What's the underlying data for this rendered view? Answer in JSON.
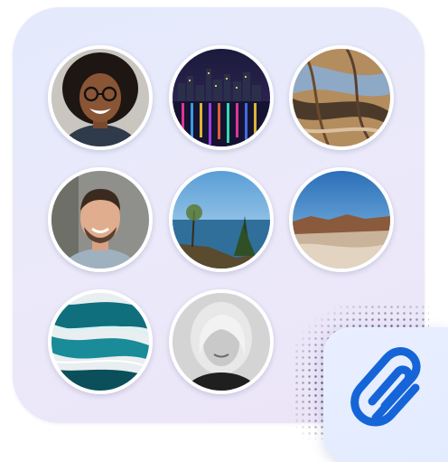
{
  "gallery": {
    "items": [
      {
        "name": "avatar-woman-glasses"
      },
      {
        "name": "photo-city-night"
      },
      {
        "name": "photo-wood-texture"
      },
      {
        "name": "avatar-man-smiling"
      },
      {
        "name": "photo-lake-tree"
      },
      {
        "name": "photo-rocky-coast"
      },
      {
        "name": "photo-teal-marble"
      },
      {
        "name": "avatar-blonde-woman"
      }
    ]
  },
  "attachment": {
    "icon": "paperclip-icon",
    "color": "#1565d8"
  },
  "colors": {
    "card": "#e6e8fb",
    "ring": "#ffffff"
  }
}
